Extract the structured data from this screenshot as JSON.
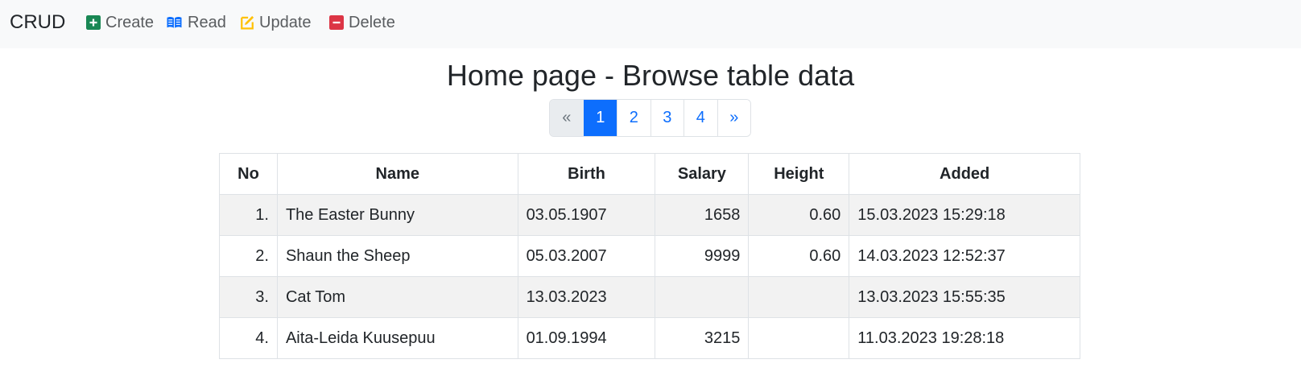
{
  "nav": {
    "brand": "CRUD",
    "items": [
      {
        "label": "Create",
        "icon": "plus-square-icon",
        "color": "#198754"
      },
      {
        "label": "Read",
        "icon": "book-open-icon",
        "color": "#0d6efd"
      },
      {
        "label": "Update",
        "icon": "edit-icon",
        "color": "#ffc107"
      },
      {
        "label": "Delete",
        "icon": "minus-square-icon",
        "color": "#dc3545"
      }
    ]
  },
  "page": {
    "title": "Home page - Browse table data"
  },
  "pagination": {
    "prev": "«",
    "next": "»",
    "pages": [
      "1",
      "2",
      "3",
      "4"
    ],
    "active_page": "1",
    "active_color": "#0d6efd"
  },
  "table": {
    "columns": [
      "No",
      "Name",
      "Birth",
      "Salary",
      "Height",
      "Added"
    ],
    "rows": [
      {
        "no": "1.",
        "name": "The Easter Bunny",
        "birth": "03.05.1907",
        "salary": "1658",
        "height": "0.60",
        "added": "15.03.2023 15:29:18"
      },
      {
        "no": "2.",
        "name": "Shaun the Sheep",
        "birth": "05.03.2007",
        "salary": "9999",
        "height": "0.60",
        "added": "14.03.2023 12:52:37"
      },
      {
        "no": "3.",
        "name": "Cat Tom",
        "birth": "13.03.2023",
        "salary": "",
        "height": "",
        "added": "13.03.2023 15:55:35"
      },
      {
        "no": "4.",
        "name": "Aita-Leida Kuusepuu",
        "birth": "01.09.1994",
        "salary": "3215",
        "height": "",
        "added": "11.03.2023 19:28:18"
      }
    ]
  }
}
